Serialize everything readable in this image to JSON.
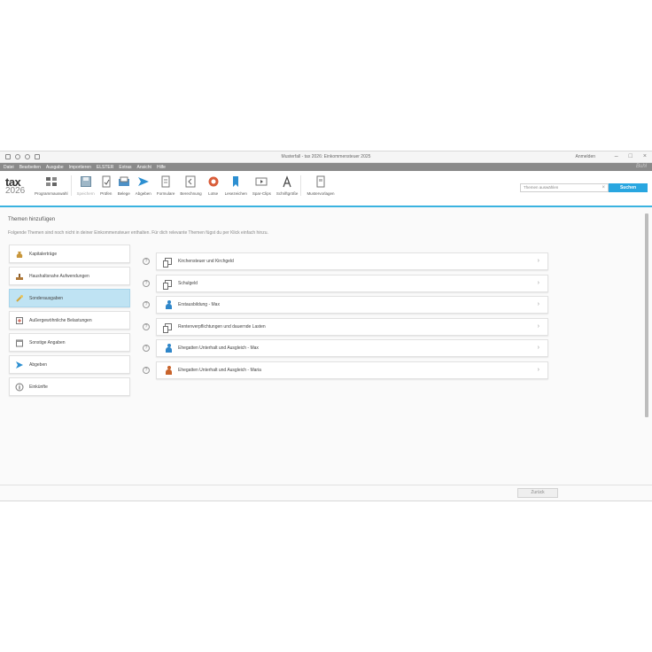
{
  "window": {
    "title": "Musterfall - tax 2026: Einkommensteuer 2025",
    "login": "Anmelden"
  },
  "menu": [
    "Datei",
    "Bearbeiten",
    "Ausgabe",
    "Importieren",
    "ELSTER",
    "Extras",
    "Ansicht",
    "Hilfe"
  ],
  "brand": "Buhl",
  "logo": {
    "line1": "tax",
    "line2": "2026"
  },
  "toolbar": [
    {
      "label": "Programmauswahl",
      "icon": "grid-icon"
    },
    {
      "label": "Speichern",
      "icon": "save-icon",
      "disabled": true
    },
    {
      "label": "Prüfen",
      "icon": "check-doc-icon"
    },
    {
      "label": "Belege",
      "icon": "receipt-icon"
    },
    {
      "label": "Abgeben",
      "icon": "send-icon"
    },
    {
      "label": "Formulare",
      "icon": "form-icon"
    },
    {
      "label": "Berechnung",
      "icon": "calculator-icon"
    },
    {
      "label": "Lotse",
      "icon": "lifebuoy-icon"
    },
    {
      "label": "Lesezeichen",
      "icon": "bookmark-icon"
    },
    {
      "label": "Spar-Clips",
      "icon": "video-icon"
    },
    {
      "label": "Schriftgröße",
      "icon": "font-size-icon"
    },
    {
      "label": "Mustervorlagen",
      "icon": "template-icon"
    }
  ],
  "search": {
    "placeholder": "Themen auswählen",
    "button": "Suchen"
  },
  "page": {
    "heading": "Themen hinzufügen",
    "hint": "Folgende Themen sind noch nicht in deiner Einkommensteuer enthalten. Für dich relevante Themen fügst du per Klick einfach hinzu."
  },
  "categories": [
    {
      "label": "Kapitalerträge",
      "active": false
    },
    {
      "label": "Haushaltsnahe Aufwendungen",
      "active": false
    },
    {
      "label": "Sonderausgaben",
      "active": true
    },
    {
      "label": "Außergewöhnliche Belastungen",
      "active": false
    },
    {
      "label": "Sonstige Angaben",
      "active": false
    },
    {
      "label": "Abgeben",
      "active": false
    },
    {
      "label": "Einkünfte",
      "active": false
    }
  ],
  "topics": [
    {
      "label": "Kirchensteuer und Kirchgeld",
      "icon": "documents-icon"
    },
    {
      "label": "Schulgeld",
      "icon": "documents-icon"
    },
    {
      "label": "Erstausbildung - Max",
      "icon": "person-male-icon"
    },
    {
      "label": "Rentenverpflichtungen und dauernde Lasten",
      "icon": "documents-icon"
    },
    {
      "label": "Ehegatten Unterhalt und Ausgleich - Max",
      "icon": "person-male-icon"
    },
    {
      "label": "Ehegatten Unterhalt und Ausgleich - Maria",
      "icon": "person-female-icon"
    }
  ],
  "help_glyph": "?",
  "chevron_glyph": "›",
  "clear_glyph": "×",
  "footer": {
    "back": "Zurück"
  },
  "colors": {
    "accent": "#29a6e0",
    "active_bg": "#bfe3f3",
    "menubar": "#8a8a8a"
  }
}
